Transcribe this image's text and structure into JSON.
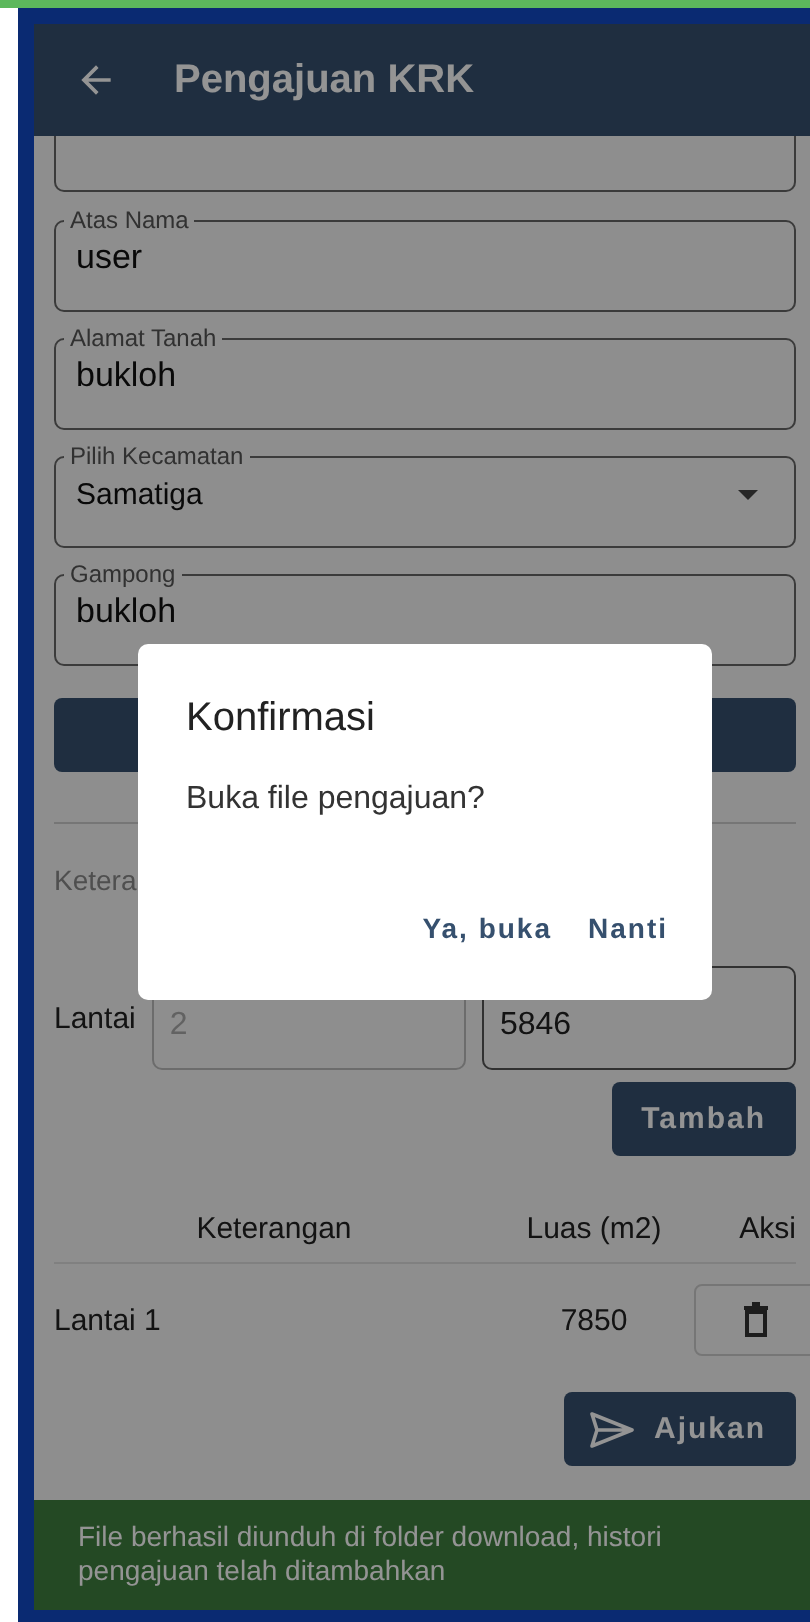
{
  "app_bar": {
    "title": "Pengajuan KRK"
  },
  "fields": [
    {
      "kind": "text",
      "label": "Atas Nama",
      "value": "user"
    },
    {
      "kind": "text",
      "label": "Alamat Tanah",
      "value": "bukloh"
    },
    {
      "kind": "dropdown",
      "label": "Pilih Kecamatan",
      "value": "Samatiga"
    },
    {
      "kind": "text",
      "label": "Gampong",
      "value": "bukloh"
    }
  ],
  "section_label": "Ketera",
  "floor_row": {
    "label": "Lantai",
    "count": {
      "value": "2",
      "disabled": true
    },
    "area": {
      "value": "5846",
      "disabled": false
    }
  },
  "add_button": "Tambah",
  "table": {
    "columns": [
      "Keterangan",
      "Luas (m2)",
      "Aksi"
    ],
    "rows": [
      {
        "keterangan": "Lantai 1",
        "luas": "7850"
      }
    ]
  },
  "submit_button": "Ajukan",
  "snackbar": "File berhasil diunduh di folder download, histori pengajuan telah ditambahkan",
  "dialog": {
    "title": "Konfirmasi",
    "message": "Buka file pengajuan?",
    "actions": [
      "Ya, buka",
      "Nanti"
    ]
  }
}
